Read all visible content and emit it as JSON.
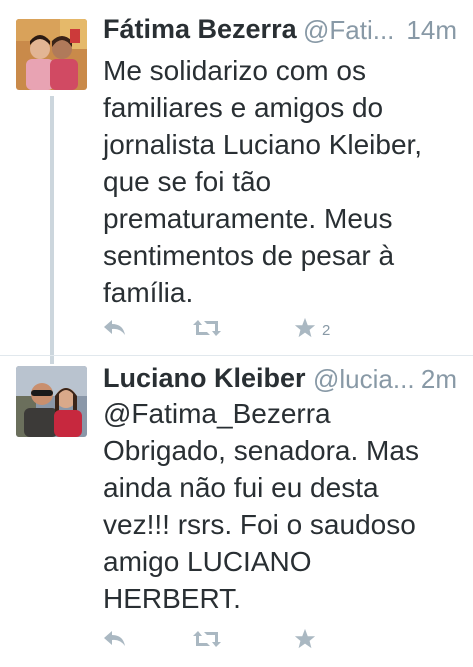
{
  "tweets": [
    {
      "name": "Fátima Bezerra",
      "handle": "@Fati...",
      "time": "14m",
      "text": "Me solidarizo com os\nfamiliares e amigos do\njornalista Luciano Kleiber,\nque se foi tão\nprematuramente. Meus\nsentimentos de pesar à\nfamília.",
      "avatar_icon": "profile-photo",
      "favorites_count": "2",
      "actions": [
        "reply-icon",
        "retweet-icon",
        "favorite-icon"
      ]
    },
    {
      "name": "Luciano Kleiber",
      "handle": "@lucia...",
      "time": "2m",
      "text": "@Fatima_Bezerra\nObrigado, senadora. Mas\nainda não fui eu desta\nvez!!! rsrs. Foi o saudoso\namigo LUCIANO\nHERBERT.",
      "avatar_icon": "profile-photo",
      "actions": [
        "reply-icon",
        "retweet-icon",
        "favorite-icon"
      ]
    }
  ],
  "colors": {
    "text": "#292f33",
    "muted": "#8899a6",
    "icon": "#aab8c2",
    "thread_line": "#ccd6dd",
    "divider": "#e1e8ed"
  }
}
